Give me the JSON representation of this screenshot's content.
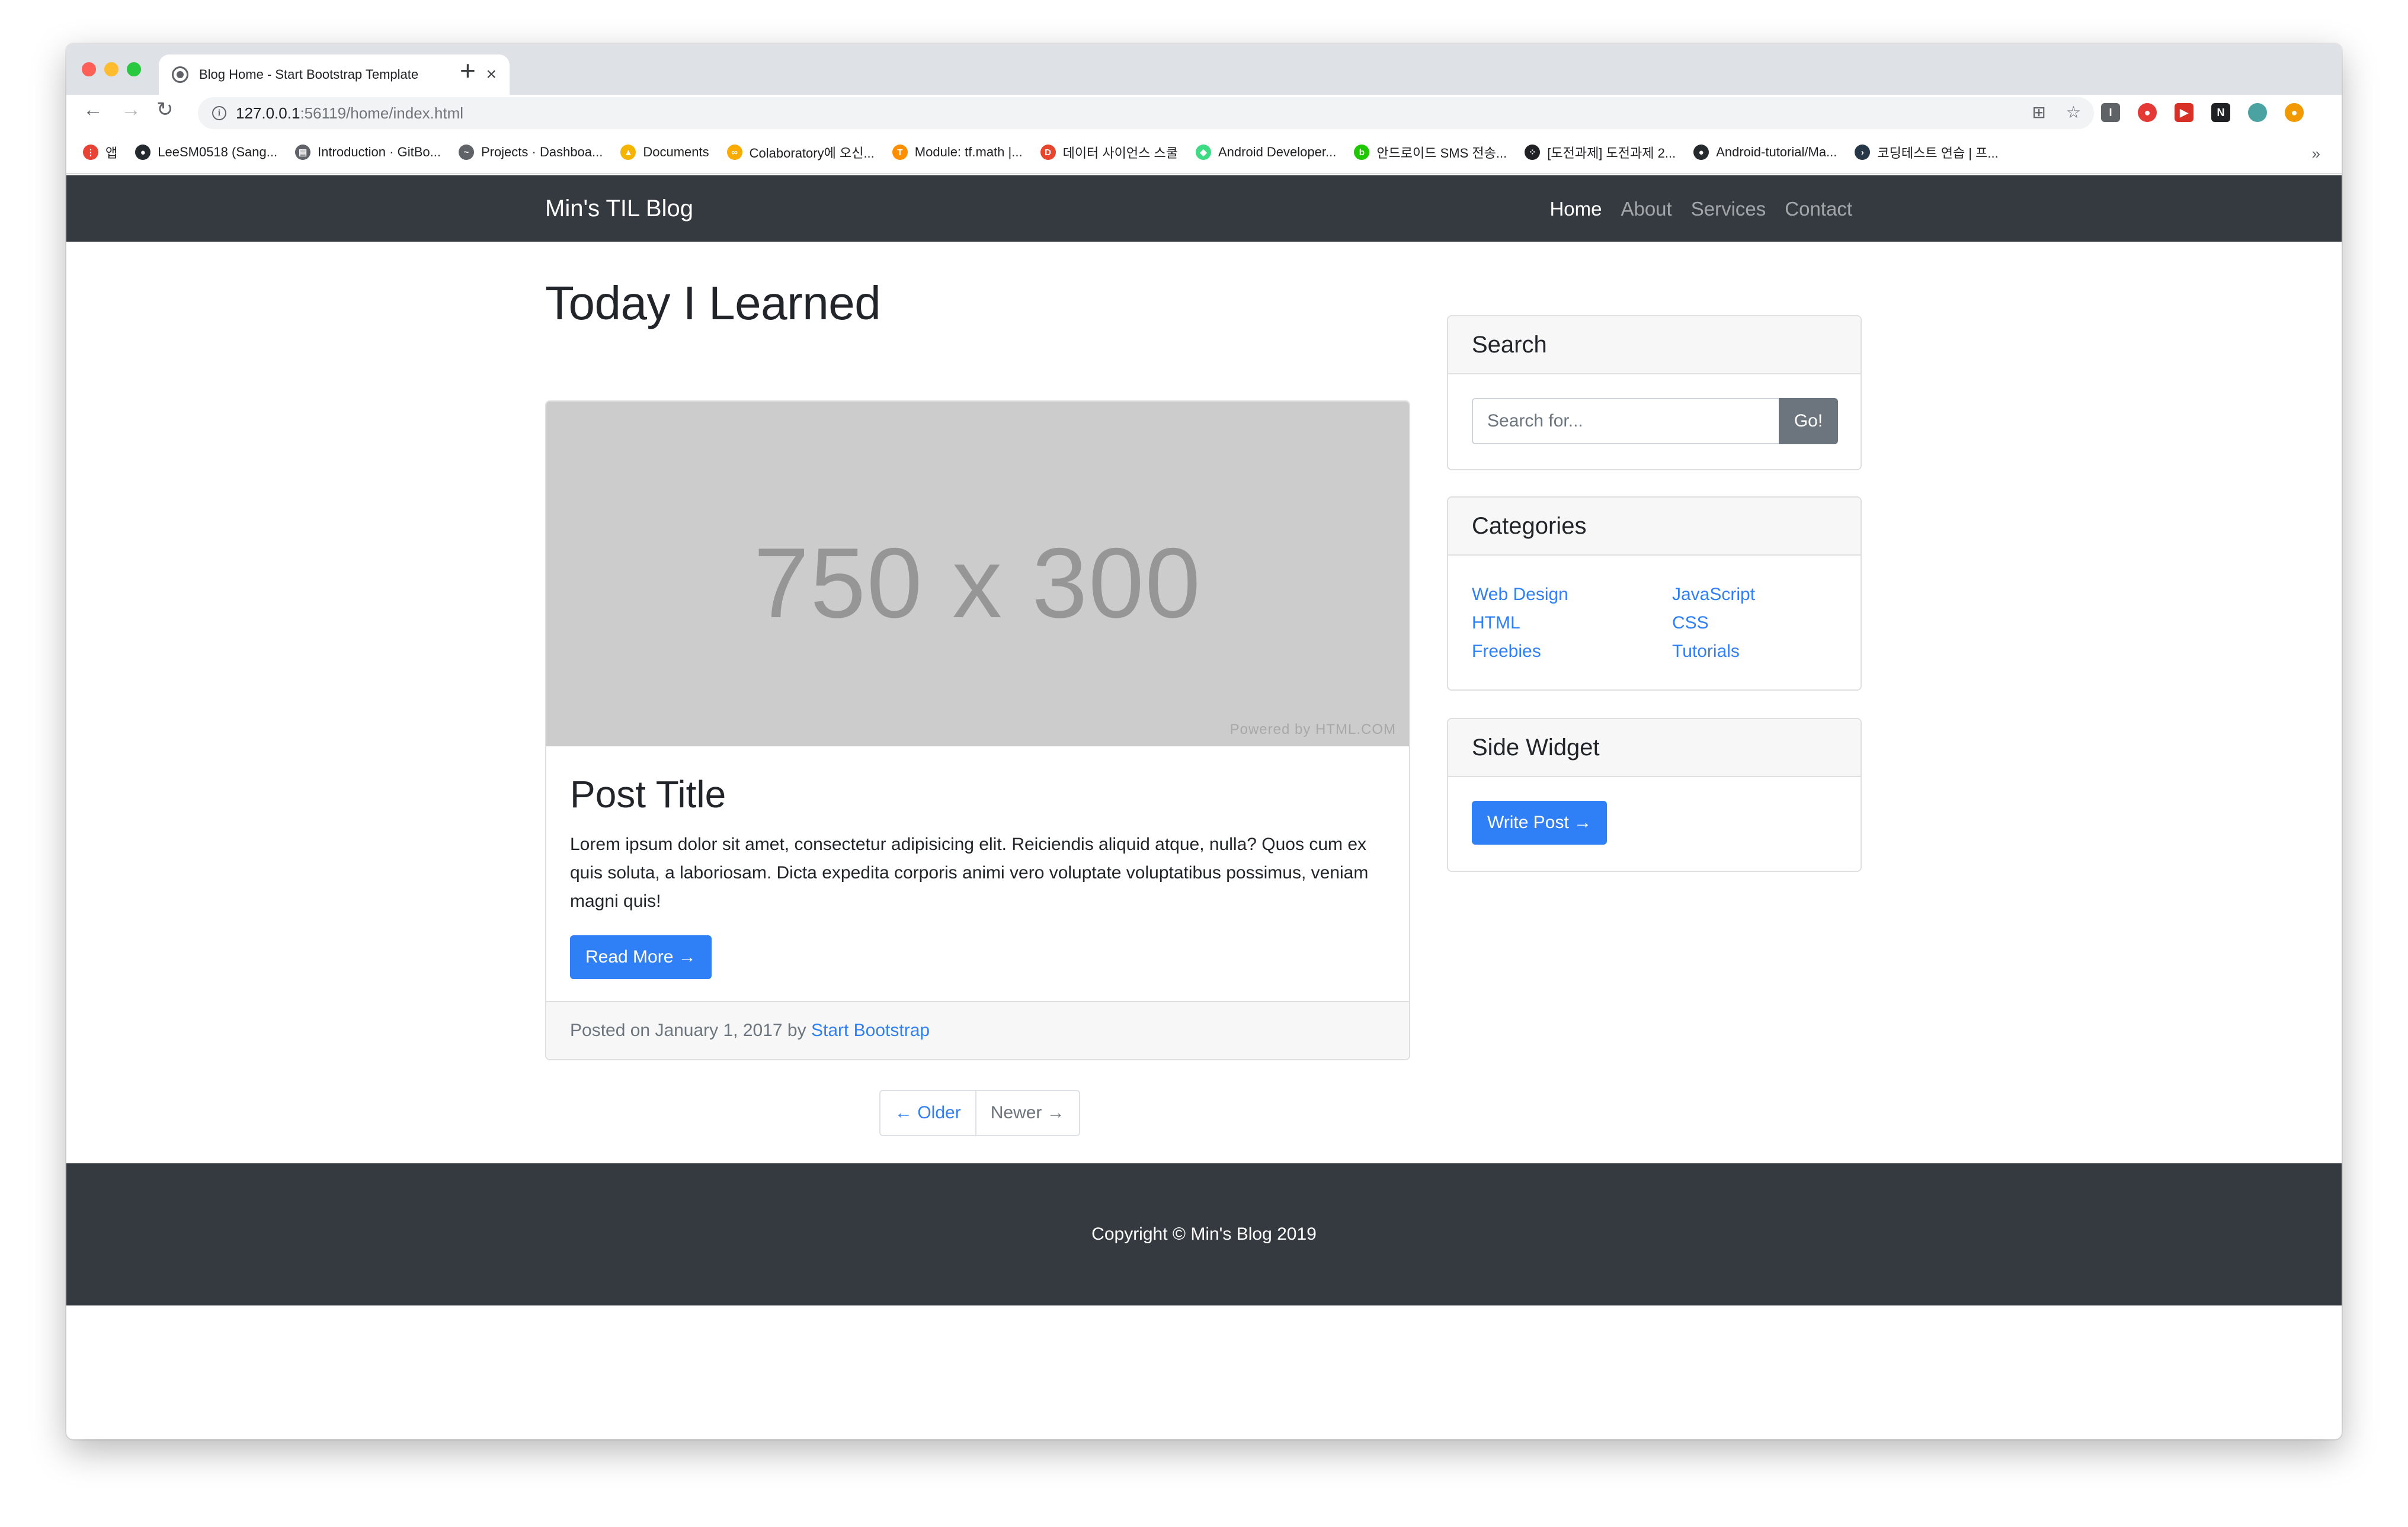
{
  "browser": {
    "tab_title": "Blog Home - Start Bootstrap Template",
    "url_host": "127.0.0.1",
    "url_rest": ":56119/home/index.html",
    "bookmarks": [
      {
        "label": "앱",
        "icon": "apps-grid-icon",
        "color": "#ea4335"
      },
      {
        "label": "LeeSM0518 (Sang...",
        "icon": "github-icon",
        "color": "#24292e"
      },
      {
        "label": "Introduction · GitBo...",
        "icon": "book-icon",
        "color": "#5f6368"
      },
      {
        "label": "Projects · Dashboa...",
        "icon": "wave-icon",
        "color": "#5f6368"
      },
      {
        "label": "Documents",
        "icon": "drive-icon",
        "color": "#f4b400"
      },
      {
        "label": "Colaboratory에 오신...",
        "icon": "colab-icon",
        "color": "#f9ab00"
      },
      {
        "label": "Module: tf.math  |...",
        "icon": "tensorflow-icon",
        "color": "#ff8f00"
      },
      {
        "label": "데이터 사이언스 스쿨",
        "icon": "ds-school-icon",
        "color": "#e8452c"
      },
      {
        "label": "Android Developer...",
        "icon": "android-icon",
        "color": "#3ddc84"
      },
      {
        "label": "안드로이드 SMS 전송...",
        "icon": "blog-icon",
        "color": "#1ec800"
      },
      {
        "label": "[도전과제] 도전과제 2...",
        "icon": "dots-icon",
        "color": "#202124"
      },
      {
        "label": "Android-tutorial/Ma...",
        "icon": "github-icon",
        "color": "#24292e"
      },
      {
        "label": "코딩테스트 연습 | 프...",
        "icon": "programmers-icon",
        "color": "#263747"
      }
    ],
    "bookmarks_more": "»"
  },
  "site": {
    "brand": "Min's TIL Blog",
    "nav": [
      "Home",
      "About",
      "Services",
      "Contact"
    ],
    "heading": "Today I Learned",
    "post": {
      "image_text": "750 x 300",
      "image_credit": "Powered by HTML.COM",
      "title": "Post Title",
      "excerpt": "Lorem ipsum dolor sit amet, consectetur adipisicing elit. Reiciendis aliquid atque, nulla? Quos cum ex quis soluta, a laboriosam. Dicta expedita corporis animi vero voluptate voluptatibus possimus, veniam magni quis!",
      "read_more": "Read More →",
      "posted_prefix": "Posted on January 1, 2017 by",
      "author": "Start Bootstrap"
    },
    "pager": {
      "older": "← Older",
      "newer": "Newer →"
    },
    "search": {
      "title": "Search",
      "placeholder": "Search for...",
      "button": "Go!"
    },
    "categories": {
      "title": "Categories",
      "items": [
        "Web Design",
        "JavaScript",
        "HTML",
        "CSS",
        "Freebies",
        "Tutorials"
      ]
    },
    "side_widget": {
      "title": "Side Widget",
      "button": "Write Post →"
    },
    "footer": "Copyright © Min's Blog 2019"
  },
  "colors": {
    "navbar": "#343a40",
    "primary": "#2f7ff7",
    "secondary": "#6c757d",
    "placeholder": "#cccccc"
  }
}
